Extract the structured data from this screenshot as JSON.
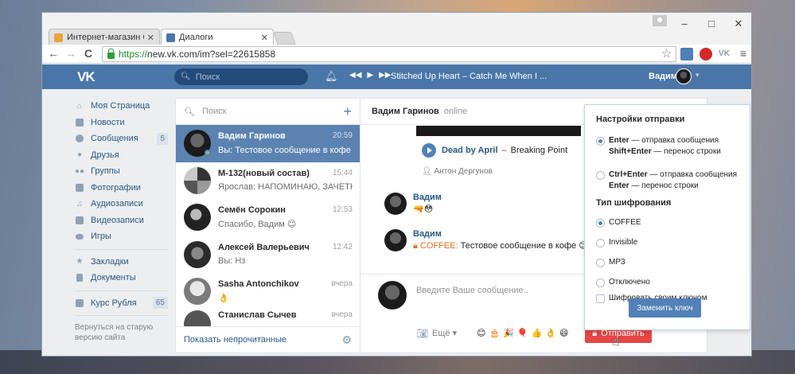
{
  "browser": {
    "tabs": [
      {
        "label": "Интернет-магазин Chrome",
        "active": false
      },
      {
        "label": "Диалоги",
        "active": true
      }
    ],
    "url_https": "https://",
    "url_rest": "new.vk.com/im?sel=22615858",
    "window_controls": {
      "minimize": "–",
      "maximize": "□",
      "close": "✕"
    },
    "nav": {
      "back": "←",
      "forward": "→",
      "reload": "C"
    }
  },
  "vk_header": {
    "logo": "VK",
    "search_placeholder": "Поиск",
    "track": "Stitched Up Heart – Catch Me When I ...",
    "user_name": "Вадим"
  },
  "left_nav": {
    "items": [
      {
        "label": "Моя Страница",
        "icon": "home-icon"
      },
      {
        "label": "Новости",
        "icon": "news-icon"
      },
      {
        "label": "Сообщения",
        "icon": "messages-icon",
        "count": "5"
      },
      {
        "label": "Друзья",
        "icon": "friends-icon"
      },
      {
        "label": "Группы",
        "icon": "groups-icon"
      },
      {
        "label": "Фотографии",
        "icon": "camera-icon"
      },
      {
        "label": "Аудиозаписи",
        "icon": "music-icon"
      },
      {
        "label": "Видеозаписи",
        "icon": "video-icon"
      },
      {
        "label": "Игры",
        "icon": "gamepad-icon"
      }
    ],
    "extra_items": [
      {
        "label": "Закладки",
        "icon": "star-icon"
      },
      {
        "label": "Документы",
        "icon": "document-icon"
      }
    ],
    "app_item": {
      "label": "Курс Рубля",
      "icon": "apps-icon",
      "count": "65"
    },
    "old_version": "Вернуться на старую версию сайта"
  },
  "dialogs": {
    "search_placeholder": "Поиск",
    "items": [
      {
        "name": "Вадим Гаринов",
        "time": "20:59",
        "message": "Вы: Тестовое сообщение в кофе 😊",
        "active": true
      },
      {
        "name": "М-132(новый состав)",
        "time": "15:44",
        "message": "Ярослав: НАПОМИНАЮ, ЗАЧЕТКИ В Д...",
        "active": false
      },
      {
        "name": "Семён Сорокин",
        "time": "12:53",
        "message": "Спасибо, Вадим 😊",
        "active": false
      },
      {
        "name": "Алексей Валерьевич",
        "time": "12:42",
        "message": "Вы: Нз",
        "active": false
      },
      {
        "name": "Sasha Antonchikov",
        "time": "вчера",
        "message": "👌",
        "active": false
      },
      {
        "name": "Станислав Сычев",
        "time": "вчера",
        "message": "",
        "active": false
      }
    ],
    "footer_link": "Показать непрочитанные"
  },
  "chat": {
    "name": "Вадим Гаринов",
    "status": "online",
    "audio": {
      "artist": "Dead by April",
      "dash": "–",
      "song": "Breaking Point"
    },
    "audio_author": "Антон Дергунов",
    "messages": [
      {
        "sender": "Вадим",
        "text": "🔫😳"
      },
      {
        "sender": "Вадим",
        "tag": "COFFEE:",
        "text": "Тестовое сообщение в кофе 😊"
      }
    ],
    "input_placeholder": "Введите Ваше сообщение..",
    "more_label": "Ещё",
    "emojis": [
      "😊",
      "🎂",
      "🎉",
      "🎈",
      "👍",
      "👌",
      "😄"
    ],
    "send_label": "Отправить"
  },
  "send_settings": {
    "title": "Настройки отправки",
    "option1": {
      "key": "Enter",
      "text": " — отправка сообщения",
      "key2": "Shift+Enter",
      "text2": " — перенос строки",
      "selected": true
    },
    "option2": {
      "key": "Ctrl+Enter",
      "text": " — отправка сообщения",
      "key2": "Enter",
      "text2": " — перенос строки",
      "selected": false
    },
    "cipher_title": "Тип шифрования",
    "cipher_options": [
      {
        "label": "COFFEE",
        "selected": true
      },
      {
        "label": "Invisible",
        "selected": false
      },
      {
        "label": "MP3",
        "selected": false
      },
      {
        "label": "Отключено",
        "selected": false
      }
    ],
    "own_key_label": "Шифровать своим ключом",
    "replace_key_button": "Заменить ключ"
  },
  "colors": {
    "vk_blue": "#4a76a8",
    "active_dialog": "#5b82b0",
    "send_red": "#e64646",
    "coffee_orange": "#e46e25"
  }
}
